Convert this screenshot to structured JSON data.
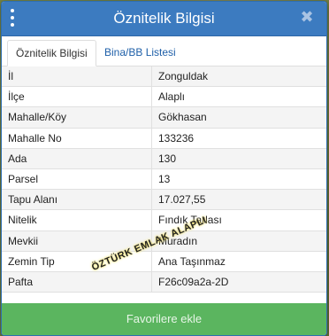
{
  "dialog": {
    "title": "Öznitelik Bilgisi",
    "close_icon": "close-icon",
    "menu_icon": "kebab-menu-icon"
  },
  "tabs": [
    {
      "label": "Öznitelik Bilgisi",
      "active": true
    },
    {
      "label": "Bina/BB Listesi",
      "active": false
    }
  ],
  "attributes": [
    {
      "key": "İl",
      "value": "Zonguldak"
    },
    {
      "key": "İlçe",
      "value": "Alaplı"
    },
    {
      "key": "Mahalle/Köy",
      "value": "Gökhasan"
    },
    {
      "key": "Mahalle No",
      "value": "133236"
    },
    {
      "key": "Ada",
      "value": "130"
    },
    {
      "key": "Parsel",
      "value": "13"
    },
    {
      "key": "Tapu Alanı",
      "value": "17.027,55"
    },
    {
      "key": "Nitelik",
      "value": "Fındık Tarlası"
    },
    {
      "key": "Mevkii",
      "value": "Muradın"
    },
    {
      "key": "Zemin Tip",
      "value": "Ana Taşınmaz"
    },
    {
      "key": "Pafta",
      "value": "F26c09a2a-2D"
    }
  ],
  "watermark": "ÖZTÜRK EMLAK ALAPLI",
  "footer": {
    "button_label": "Favorilere ekle"
  },
  "colors": {
    "header": "#3c7bc0",
    "footer_button": "#5bb55f",
    "tab_link": "#1e5fa8"
  }
}
